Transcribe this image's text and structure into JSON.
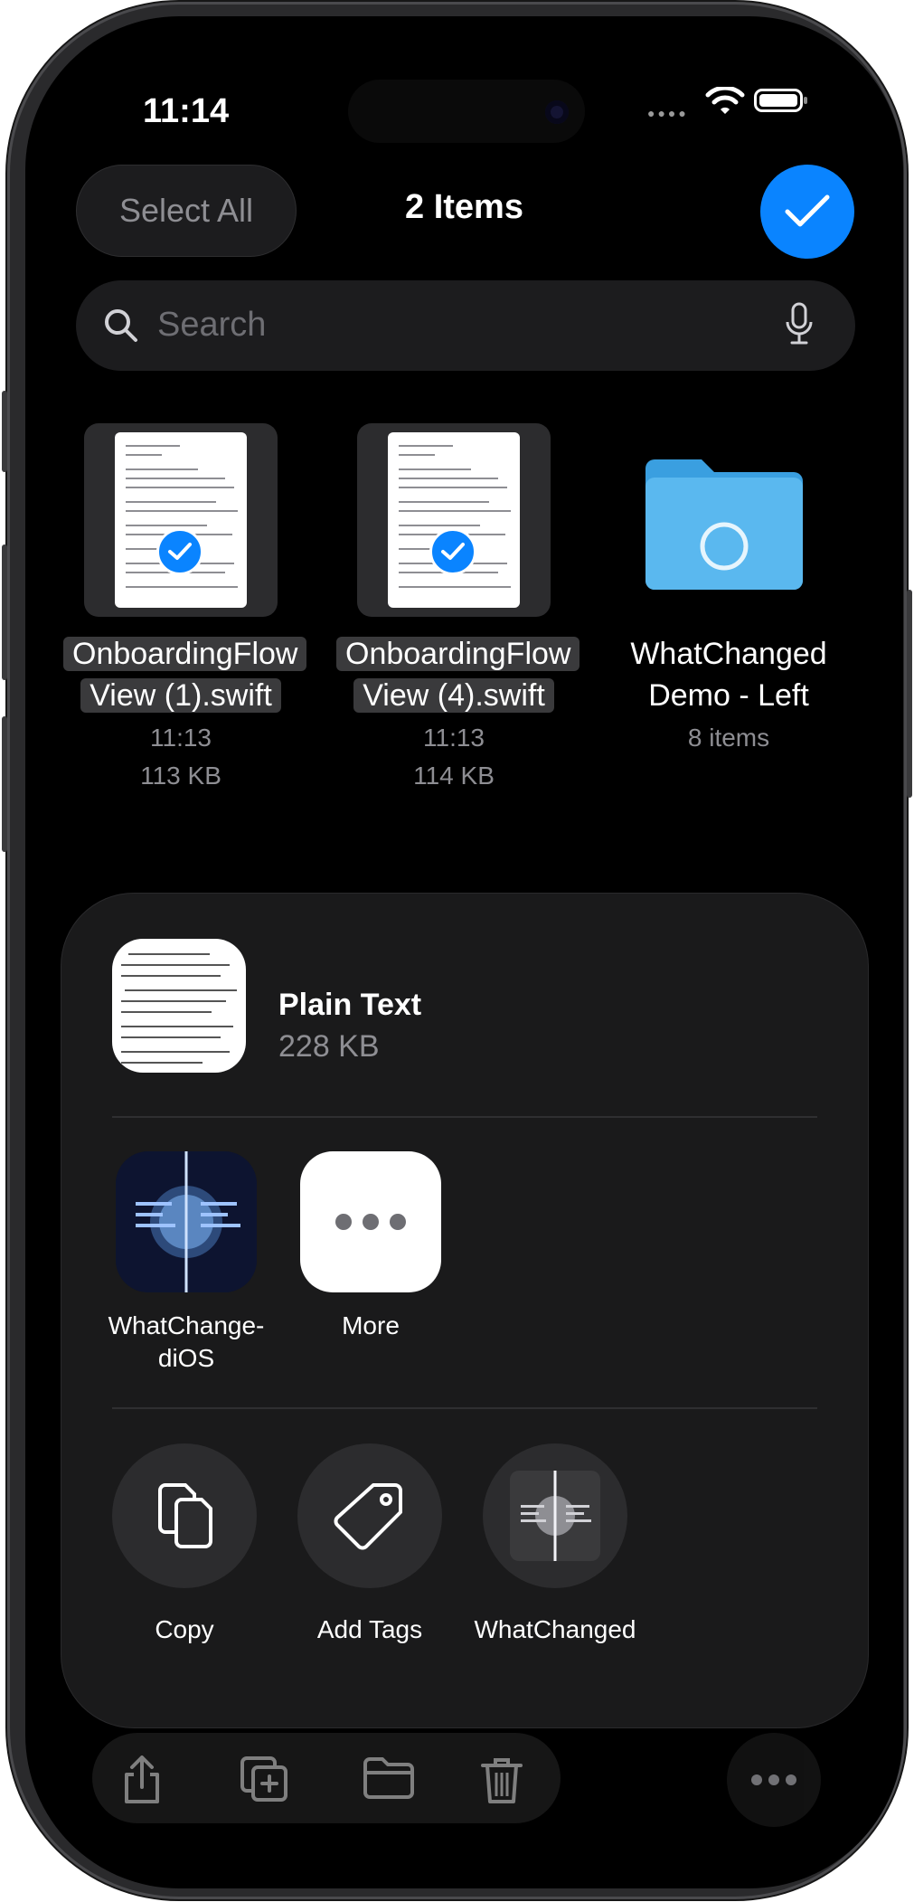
{
  "status_bar": {
    "time": "11:14"
  },
  "header": {
    "select_all_label": "Select All",
    "title": "2 Items"
  },
  "search": {
    "placeholder": "Search"
  },
  "files": [
    {
      "name_line1": "OnboardingFlow",
      "name_line2": "View (1).swift",
      "time": "11:13",
      "size": "113 KB",
      "selected": true
    },
    {
      "name_line1": "OnboardingFlow",
      "name_line2": "View (4).swift",
      "time": "11:13",
      "size": "114 KB",
      "selected": true
    },
    {
      "name_line1": "WhatChanged",
      "name_line2": "Demo - Left",
      "items": "8 items",
      "type": "folder"
    }
  ],
  "share_sheet": {
    "file_type": "Plain Text",
    "file_size": "228 KB",
    "apps": [
      {
        "label_line1": "WhatChange-",
        "label_line2": "diOS",
        "icon": "whatchanged-app-icon"
      },
      {
        "label_line1": "More",
        "label_line2": "",
        "icon": "more-icon"
      }
    ],
    "actions": [
      {
        "label": "Copy",
        "icon": "copy-icon"
      },
      {
        "label": "Add Tags",
        "icon": "tag-icon"
      },
      {
        "label": "WhatChanged",
        "icon": "whatchanged-action-icon"
      }
    ]
  },
  "toolbar": {
    "icons": [
      "share-icon",
      "duplicate-icon",
      "folder-icon",
      "trash-icon"
    ],
    "more_icon": "ellipsis-icon"
  },
  "colors": {
    "accent": "#0a84ff",
    "background": "#000000",
    "sheet": "#1a1a1b"
  }
}
